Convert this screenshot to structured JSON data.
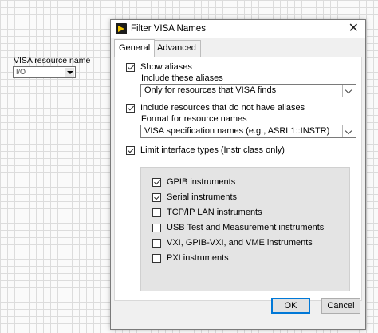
{
  "front_panel": {
    "label": "VISA resource name",
    "io_icon": "I/O"
  },
  "dialog": {
    "title": "Filter VISA Names",
    "tabs": [
      {
        "label": "General",
        "active": true
      },
      {
        "label": "Advanced",
        "active": false
      }
    ],
    "show_aliases": {
      "label": "Show aliases",
      "checked": true
    },
    "include_aliases_label": "Include these aliases",
    "aliases_select": "Only for resources that VISA finds",
    "include_no_alias": {
      "label": "Include resources that do not have aliases",
      "checked": true
    },
    "format_label": "Format for resource names",
    "format_select": "VISA specification names (e.g., ASRL1::INSTR)",
    "limit_iface": {
      "label": "Limit interface types (Instr class only)",
      "checked": true
    },
    "interfaces": [
      {
        "label": "GPIB instruments",
        "checked": true
      },
      {
        "label": "Serial instruments",
        "checked": true
      },
      {
        "label": "TCP/IP LAN instruments",
        "checked": false
      },
      {
        "label": "USB Test and Measurement instruments",
        "checked": false
      },
      {
        "label": "VXI, GPIB-VXI, and VME instruments",
        "checked": false
      },
      {
        "label": "PXI instruments",
        "checked": false
      }
    ],
    "ok_label": "OK",
    "cancel_label": "Cancel",
    "close_glyph": "✕"
  }
}
